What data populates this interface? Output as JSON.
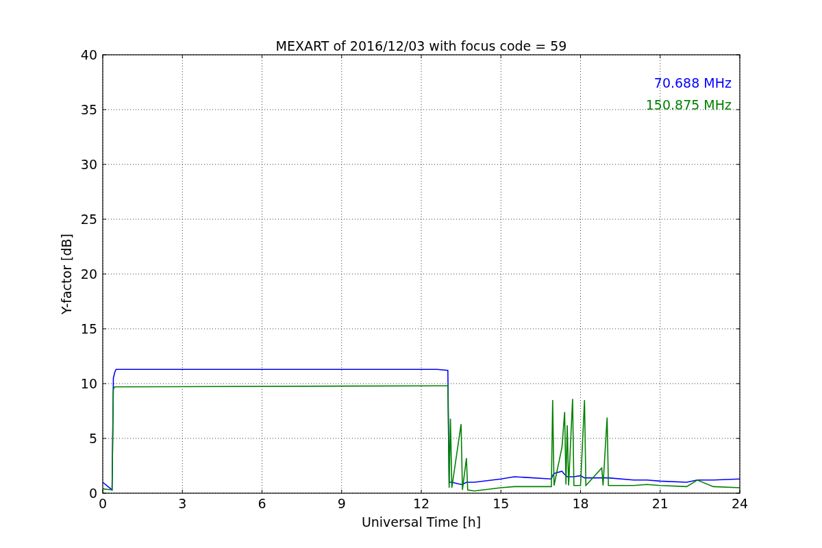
{
  "chart_data": {
    "type": "line",
    "title": "MEXART of 2016/12/03 with focus code = 59",
    "xlabel": "Universal Time [h]",
    "ylabel": "Y-factor [dB]",
    "x": [
      0,
      0.35,
      0.4,
      0.45,
      0.5,
      12.6,
      13.0,
      13.05,
      13.1,
      13.15,
      13.5,
      13.55,
      13.7,
      13.75,
      14,
      15,
      15.5,
      16.9,
      16.95,
      17,
      17.3,
      17.4,
      17.45,
      17.5,
      17.55,
      17.7,
      17.75,
      18,
      18.15,
      18.2,
      18.8,
      18.85,
      19,
      19.05,
      20,
      20.5,
      21,
      22,
      22.4,
      23,
      24
    ],
    "series": [
      {
        "name": "70.688 MHz",
        "color": "#0000ff",
        "values": [
          1.0,
          0.3,
          10.5,
          11.0,
          11.3,
          11.3,
          11.2,
          1.0,
          1.0,
          1.0,
          0.8,
          0.8,
          1.0,
          1.0,
          1.0,
          1.3,
          1.5,
          1.3,
          1.6,
          1.8,
          2.0,
          1.7,
          1.6,
          1.5,
          1.5,
          1.5,
          1.5,
          1.6,
          1.4,
          1.4,
          1.4,
          1.4,
          1.4,
          1.4,
          1.2,
          1.2,
          1.1,
          1.0,
          1.2,
          1.2,
          1.3
        ]
      },
      {
        "name": "150.875 MHz",
        "color": "#008000",
        "values": [
          0.4,
          0.3,
          9.5,
          9.7,
          9.7,
          9.8,
          9.8,
          0.5,
          6.8,
          0.5,
          6.3,
          0.3,
          3.2,
          0.3,
          0.2,
          0.5,
          0.6,
          0.6,
          8.5,
          0.7,
          4.2,
          7.4,
          0.8,
          6.2,
          0.7,
          8.6,
          0.7,
          0.7,
          8.5,
          0.7,
          2.3,
          0.7,
          6.9,
          0.7,
          0.7,
          0.8,
          0.7,
          0.6,
          1.2,
          0.6,
          0.5
        ]
      }
    ],
    "grid": true,
    "xlim": [
      0,
      24
    ],
    "ylim": [
      0,
      40
    ],
    "xticks": [
      0,
      3,
      6,
      9,
      12,
      15,
      18,
      21,
      24
    ],
    "yticks": [
      0,
      5,
      10,
      15,
      20,
      25,
      30,
      35,
      40
    ]
  }
}
